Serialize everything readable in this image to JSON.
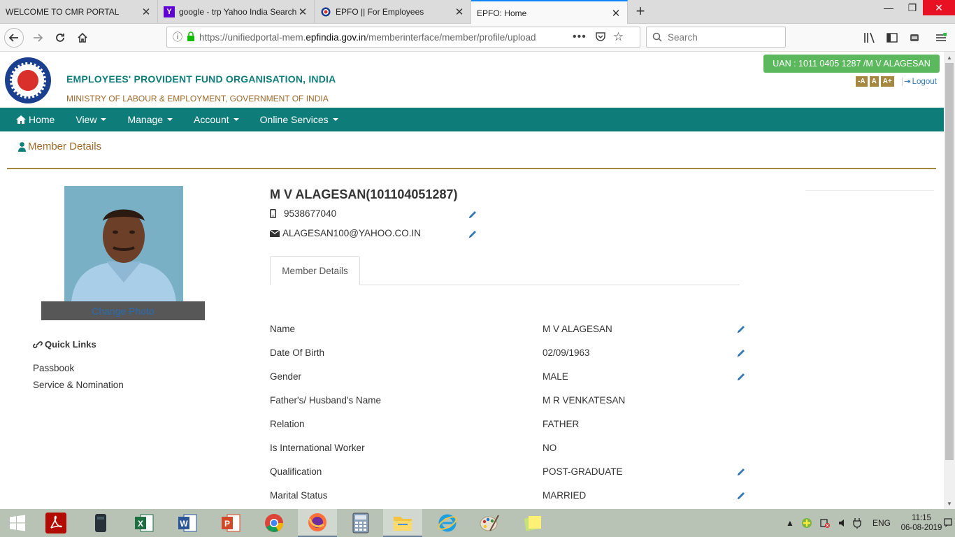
{
  "browser": {
    "tabs": [
      {
        "label": "WELCOME TO CMR PORTAL",
        "favicon": ""
      },
      {
        "label": "google - trp Yahoo India Search",
        "favicon": "Y"
      },
      {
        "label": "EPFO || For Employees",
        "favicon": "epfo-icon"
      },
      {
        "label": "EPFO: Home",
        "favicon": ""
      }
    ],
    "url_prefix": "https://unifiedportal-mem.",
    "url_domain": "epfindia.gov.in",
    "url_path": "/memberinterface/member/profile/upload",
    "search_placeholder": "Search"
  },
  "header": {
    "org_name": "EMPLOYEES' PROVIDENT FUND ORGANISATION, INDIA",
    "ministry": "MINISTRY OF LABOUR & EMPLOYMENT, GOVERNMENT OF INDIA",
    "uan": "UAN : 1011 0405 1287 /M V ALAGESAN",
    "font_small": "-A",
    "font_normal": "A",
    "font_large": "A+",
    "logout": "Logout"
  },
  "nav": {
    "home": "Home",
    "view": "View",
    "manage": "Manage",
    "account": "Account",
    "online_services": "Online Services"
  },
  "page": {
    "section_title": "Member Details",
    "change_photo": "Change Photo",
    "quick_links_title": "Quick Links",
    "quick_links": [
      "Passbook",
      "Service & Nomination"
    ]
  },
  "member": {
    "name_header": "M V ALAGESAN(101104051287)",
    "phone": "9538677040",
    "email": "ALAGESAN100@YAHOO.CO.IN",
    "tab_label": "Member Details",
    "rows": [
      {
        "label": "Name",
        "value": "M V ALAGESAN",
        "editable": true
      },
      {
        "label": "Date Of Birth",
        "value": "02/09/1963",
        "editable": true
      },
      {
        "label": "Gender",
        "value": "MALE",
        "editable": true
      },
      {
        "label": "Father's/ Husband's Name",
        "value": "M R VENKATESAN",
        "editable": false
      },
      {
        "label": "Relation",
        "value": "FATHER",
        "editable": false
      },
      {
        "label": "Is International Worker",
        "value": "NO",
        "editable": false
      },
      {
        "label": "Qualification",
        "value": "POST-GRADUATE",
        "editable": true
      },
      {
        "label": "Marital Status",
        "value": "MARRIED",
        "editable": true
      }
    ]
  },
  "taskbar": {
    "lang": "ENG",
    "time": "11:15",
    "date": "06-08-2019"
  },
  "colors": {
    "teal": "#0e7d7a",
    "gold": "#a5873f",
    "uan_green": "#5cb85c",
    "link_blue": "#337ab7"
  }
}
